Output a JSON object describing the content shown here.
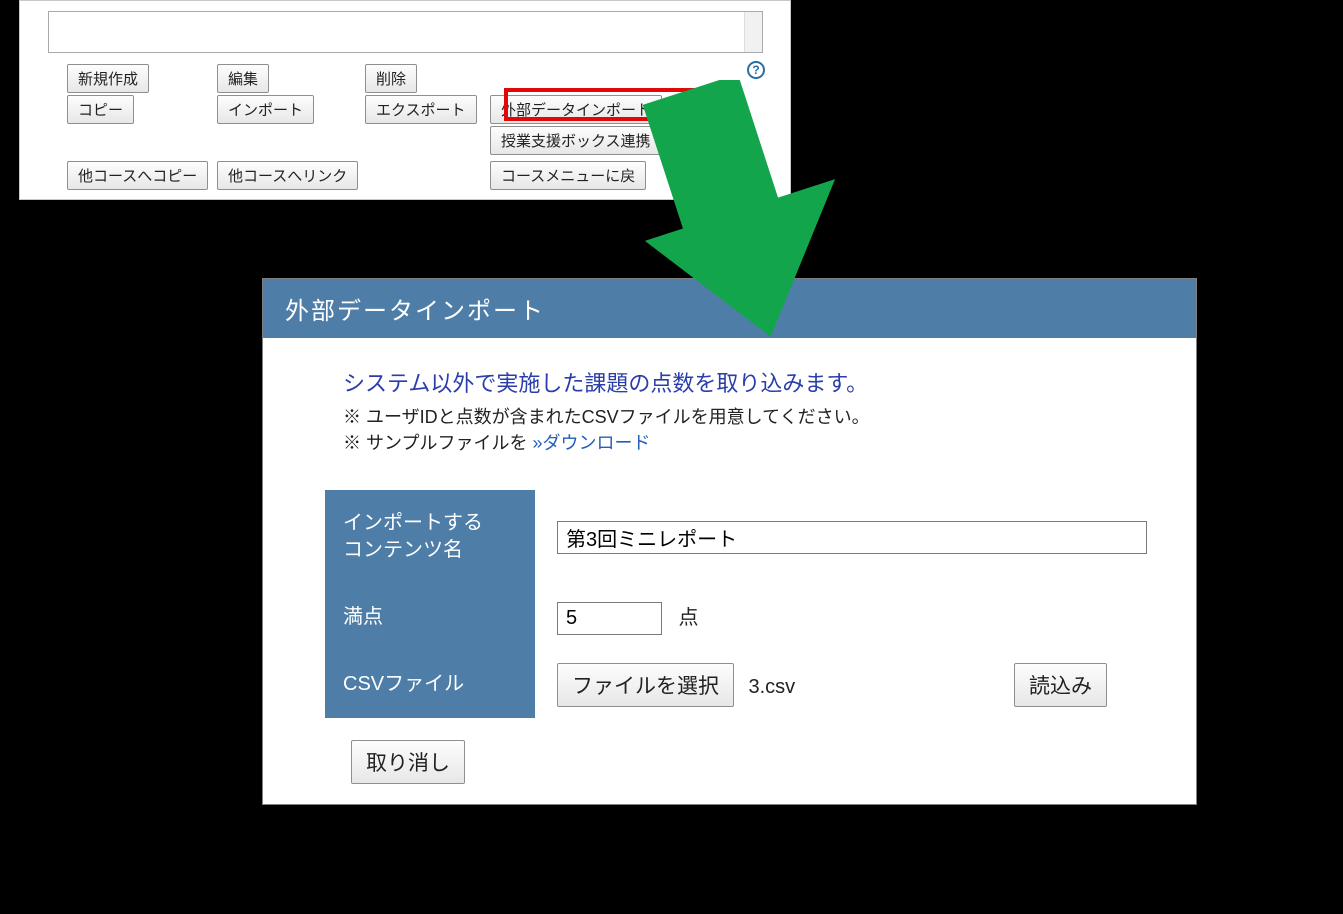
{
  "top_panel": {
    "buttons": {
      "new": "新規作成",
      "edit": "編集",
      "delete": "削除",
      "copy": "コピー",
      "import": "インポート",
      "export": "エクスポート",
      "external_import": "外部データインポート",
      "class_box": "授業支援ボックス連携",
      "copy_other": "他コースへコピー",
      "link_other": "他コースへリンク",
      "course_menu": "コースメニューに戻"
    },
    "help": "?"
  },
  "bottom_panel": {
    "title": "外部データインポート",
    "desc_main": "システム以外で実施した課題の点数を取り込みます。",
    "desc_bullet1_pre": "※ ユーザIDと点数が含まれたCSVファイルを用意してください。",
    "desc_bullet2_pre": "※ サンプルファイルを ",
    "desc_download_arrow": "»",
    "desc_download_link": "ダウンロード",
    "labels": {
      "content_name_l1": "インポートする",
      "content_name_l2": "コンテンツ名",
      "max_points": "満点",
      "csv_file": "CSVファイル"
    },
    "values": {
      "content_name": "第3回ミニレポート",
      "max_points": "5",
      "points_suffix": "点",
      "file_select_btn": "ファイルを選択",
      "file_name": "3.csv",
      "load_btn": "読込み"
    },
    "cancel_btn": "取り消し"
  }
}
